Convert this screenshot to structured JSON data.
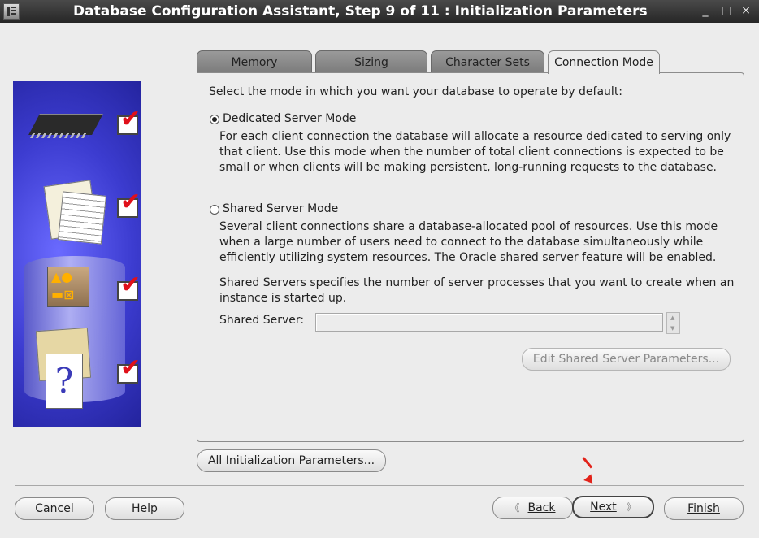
{
  "window": {
    "title": "Database Configuration Assistant, Step 9 of 11 : Initialization Parameters",
    "minimize_glyph": "_",
    "maximize_glyph": "□",
    "close_glyph": "×"
  },
  "left_panel": {
    "steps": [
      {
        "icon": "memory-chip-icon",
        "checked": true
      },
      {
        "icon": "documents-icon",
        "checked": true
      },
      {
        "icon": "shapes-icon",
        "checked": true
      },
      {
        "icon": "help-document-icon",
        "checked": true
      }
    ],
    "check_glyph": "✔",
    "help_glyph": "?"
  },
  "tabs": [
    {
      "label": "Memory",
      "active": false
    },
    {
      "label": "Sizing",
      "active": false
    },
    {
      "label": "Character Sets",
      "active": false
    },
    {
      "label": "Connection Mode",
      "active": true
    }
  ],
  "connection_mode": {
    "intro": "Select the mode in which you want your database to operate by default:",
    "dedicated": {
      "label": "Dedicated Server Mode",
      "selected": true,
      "description": "For each client connection the database will allocate a resource dedicated to serving only that client.  Use this mode when the number of total client connections is expected to be small or when clients will be making persistent, long-running requests to the database."
    },
    "shared": {
      "label": "Shared Server Mode",
      "selected": false,
      "description": "Several client connections share a database-allocated pool of resources.  Use this mode when a large number of users need to connect to the database simultaneously while efficiently utilizing system resources.  The Oracle shared server feature will be enabled."
    },
    "shared_servers_note": "Shared Servers specifies the number of server processes that you want to create when an instance is started up.",
    "shared_server_label": "Shared Server:",
    "shared_server_value": "",
    "edit_button": "Edit Shared Server Parameters..."
  },
  "all_params_button": "All Initialization Parameters...",
  "footer": {
    "cancel": "Cancel",
    "help": "Help",
    "back": "Back",
    "next": "Next",
    "finish": "Finish",
    "back_glyph": "《",
    "next_glyph": "》"
  }
}
